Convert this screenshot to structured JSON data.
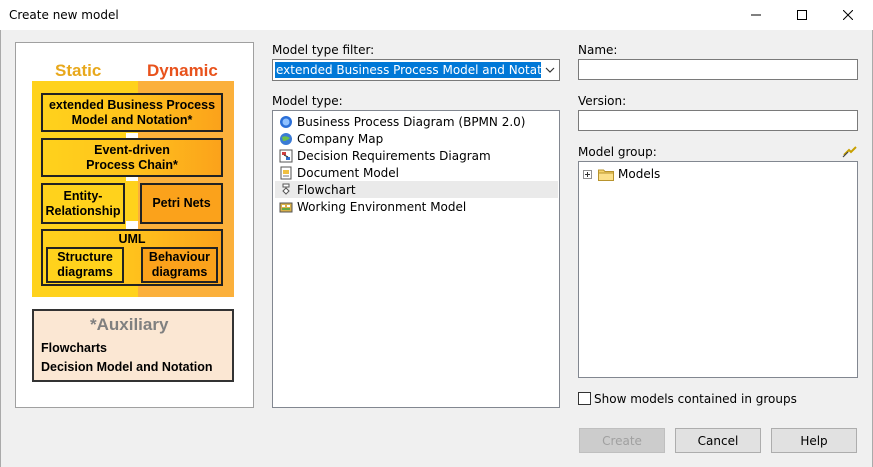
{
  "window": {
    "title": "Create new model",
    "minimize_icon": "minimize-icon",
    "maximize_icon": "maximize-icon",
    "close_icon": "close-icon"
  },
  "diagram": {
    "static_label": "Static",
    "dynamic_label": "Dynamic",
    "ebpmn_line1": "extended Business Process",
    "ebpmn_line2": "Model and Notation*",
    "epc_line1": "Event-driven",
    "epc_line2": "Process Chain*",
    "er_line1": "Entity-",
    "er_line2": "Relationship",
    "petri": "Petri Nets",
    "uml": "UML",
    "structure_line1": "Structure",
    "structure_line2": "diagrams",
    "behaviour_line1": "Behaviour",
    "behaviour_line2": "diagrams",
    "aux_title": "*Auxiliary",
    "aux_item1": "Flowcharts",
    "aux_item2": "Decision Model and Notation",
    "colors": {
      "static": "#ffd21c",
      "dynamic": "#fba21b",
      "auxiliary": "#fbe7d3",
      "static_text": "#e8a81c",
      "dynamic_text": "#e8521c",
      "aux_text": "#808080"
    }
  },
  "model_type_filter": {
    "label": "Model type filter:",
    "selected": "extended Business Process Model and Notation"
  },
  "model_type": {
    "label": "Model type:",
    "items": [
      {
        "label": "Business Process Diagram (BPMN 2.0)",
        "icon": "bpmn-icon"
      },
      {
        "label": "Company Map",
        "icon": "company-map-icon"
      },
      {
        "label": "Decision Requirements Diagram",
        "icon": "decision-requirements-icon"
      },
      {
        "label": "Document Model",
        "icon": "document-model-icon"
      },
      {
        "label": "Flowchart",
        "icon": "flowchart-icon"
      },
      {
        "label": "Working Environment Model",
        "icon": "working-environment-icon"
      }
    ],
    "highlighted_index": 4
  },
  "name": {
    "label": "Name:",
    "value": ""
  },
  "version": {
    "label": "Version:",
    "value": ""
  },
  "model_group": {
    "label": "Model group:",
    "tree_root": "Models"
  },
  "show_models_checkbox": {
    "label": "Show models contained in groups",
    "checked": false
  },
  "buttons": {
    "create": "Create",
    "cancel": "Cancel",
    "help": "Help"
  }
}
